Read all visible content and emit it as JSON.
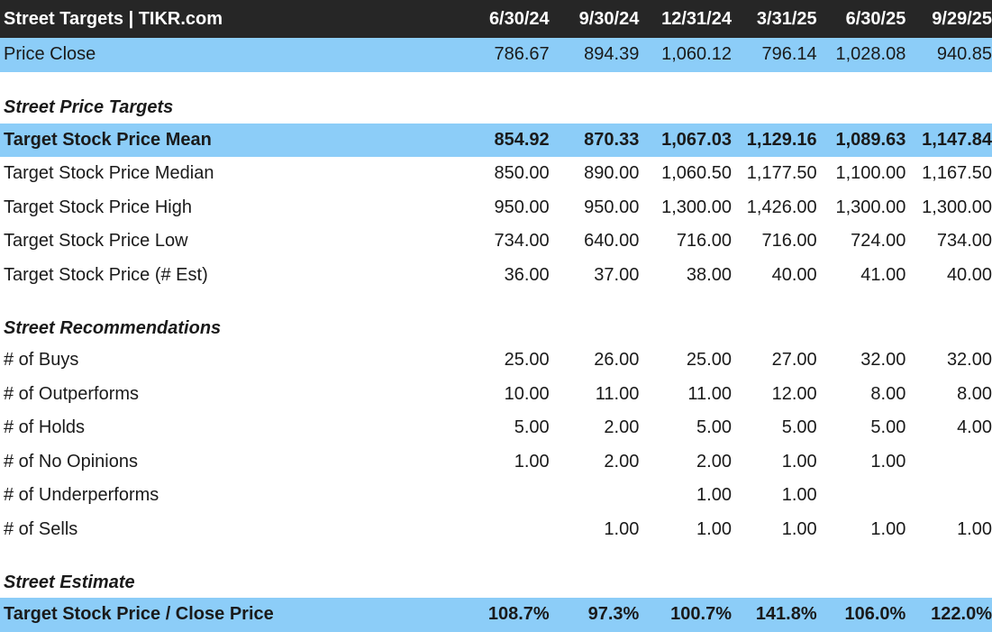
{
  "header": {
    "title": "Street Targets | TIKR.com",
    "columns": [
      "6/30/24",
      "9/30/24",
      "12/31/24",
      "3/31/25",
      "6/30/25",
      "9/29/25"
    ]
  },
  "price_close": {
    "label": "Price Close",
    "values": [
      "786.67",
      "894.39",
      "1,060.12",
      "796.14",
      "1,028.08",
      "940.85"
    ]
  },
  "sections": {
    "price_targets": {
      "title": "Street Price Targets",
      "rows": [
        {
          "label": "Target Stock Price Mean",
          "values": [
            "854.92",
            "870.33",
            "1,067.03",
            "1,129.16",
            "1,089.63",
            "1,147.84"
          ]
        },
        {
          "label": "Target Stock Price Median",
          "values": [
            "850.00",
            "890.00",
            "1,060.50",
            "1,177.50",
            "1,100.00",
            "1,167.50"
          ]
        },
        {
          "label": "Target Stock Price High",
          "values": [
            "950.00",
            "950.00",
            "1,300.00",
            "1,426.00",
            "1,300.00",
            "1,300.00"
          ]
        },
        {
          "label": "Target Stock Price Low",
          "values": [
            "734.00",
            "640.00",
            "716.00",
            "716.00",
            "724.00",
            "734.00"
          ]
        },
        {
          "label": "Target Stock Price (# Est)",
          "values": [
            "36.00",
            "37.00",
            "38.00",
            "40.00",
            "41.00",
            "40.00"
          ]
        }
      ]
    },
    "recommendations": {
      "title": "Street Recommendations",
      "rows": [
        {
          "label": "# of Buys",
          "values": [
            "25.00",
            "26.00",
            "25.00",
            "27.00",
            "32.00",
            "32.00"
          ]
        },
        {
          "label": "# of Outperforms",
          "values": [
            "10.00",
            "11.00",
            "11.00",
            "12.00",
            "8.00",
            "8.00"
          ]
        },
        {
          "label": "# of Holds",
          "values": [
            "5.00",
            "2.00",
            "5.00",
            "5.00",
            "5.00",
            "4.00"
          ]
        },
        {
          "label": "# of No Opinions",
          "values": [
            "1.00",
            "2.00",
            "2.00",
            "1.00",
            "1.00",
            ""
          ]
        },
        {
          "label": "# of Underperforms",
          "values": [
            "",
            "",
            "1.00",
            "1.00",
            "",
            ""
          ]
        },
        {
          "label": "# of Sells",
          "values": [
            "",
            "1.00",
            "1.00",
            "1.00",
            "1.00",
            "1.00"
          ]
        }
      ]
    },
    "estimate": {
      "title": "Street Estimate",
      "rows": [
        {
          "label": "Target Stock Price / Close Price",
          "values": [
            "108.7%",
            "97.3%",
            "100.7%",
            "141.8%",
            "106.0%",
            "122.0%"
          ]
        }
      ]
    }
  },
  "colors": {
    "header_bg": "#262626",
    "highlight_bg": "#8ccdf8"
  }
}
